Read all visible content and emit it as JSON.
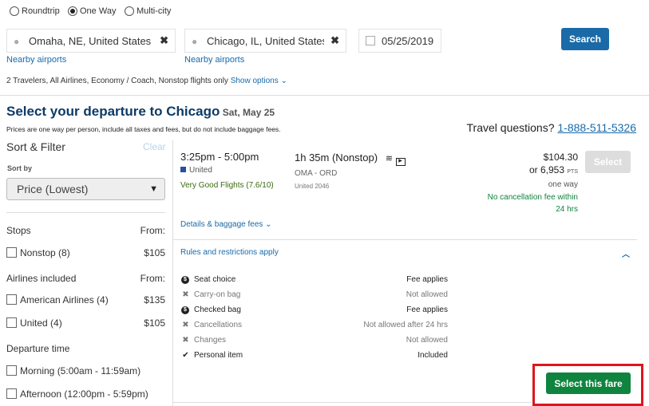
{
  "trip_types": [
    {
      "label": "Roundtrip",
      "selected": false
    },
    {
      "label": "One Way",
      "selected": true
    },
    {
      "label": "Multi-city",
      "selected": false
    }
  ],
  "search": {
    "origin": "Omaha, NE, United States (O",
    "destination": "Chicago, IL, United States",
    "date": "05/25/2019",
    "nearby": "Nearby airports",
    "search_label": "Search",
    "summary": "2 Travelers, All Airlines, Economy / Coach, Nonstop flights only",
    "show_options": "Show options ⌄"
  },
  "header": {
    "title": "Select your departure to Chicago",
    "date": "Sat, May 25",
    "note": "Prices are one way per person, include all taxes and fees, but do not include baggage fees.",
    "questions": "Travel questions?",
    "phone": "1-888-511-5326"
  },
  "sidebar": {
    "title": "Sort & Filter",
    "clear": "Clear",
    "sort_label": "Sort by",
    "sort_value": "Price (Lowest)",
    "stops": {
      "title": "Stops",
      "from": "From:",
      "items": [
        {
          "label": "Nonstop (8)",
          "price": "$105"
        }
      ]
    },
    "airlines": {
      "title": "Airlines included",
      "from": "From:",
      "items": [
        {
          "label": "American Airlines (4)",
          "price": "$135"
        },
        {
          "label": "United (4)",
          "price": "$105"
        }
      ]
    },
    "departure": {
      "title": "Departure time",
      "items": [
        {
          "label": "Morning (5:00am - 11:59am)"
        },
        {
          "label": "Afternoon (12:00pm - 5:59pm)"
        }
      ]
    }
  },
  "flight": {
    "times": "3:25pm - 5:00pm",
    "airline": "United",
    "rating": "Very Good Flights (7.6/10)",
    "duration": "1h 35m (Nonstop)",
    "route": "OMA - ORD",
    "flight_no": "United 2046",
    "price": "$104.30",
    "points": "or 6,953",
    "pts": "PTS",
    "one_way": "one way",
    "cancel1": "No cancellation fee within",
    "cancel2": "24 hrs",
    "select": "Select",
    "details": "Details & baggage fees ⌄",
    "rules_title": "Rules and restrictions apply",
    "rules": [
      {
        "icon": "dollar-icon",
        "label": "Seat choice",
        "value": "Fee applies",
        "strong": true
      },
      {
        "icon": "x-icon",
        "label": "Carry-on bag",
        "value": "Not allowed",
        "strong": false
      },
      {
        "icon": "dollar-icon",
        "label": "Checked bag",
        "value": "Fee applies",
        "strong": true
      },
      {
        "icon": "x-icon",
        "label": "Cancellations",
        "value": "Not allowed after 24 hrs",
        "strong": false
      },
      {
        "icon": "x-icon",
        "label": "Changes",
        "value": "Not allowed",
        "strong": false
      },
      {
        "icon": "check-icon",
        "label": "Personal item",
        "value": "Included",
        "strong": true
      }
    ],
    "select_fare": "Select this fare"
  },
  "colors": {
    "brand": "#1a6aa8",
    "green": "#0f843e",
    "highlight": "#e0141e",
    "title": "#0d3b66"
  }
}
